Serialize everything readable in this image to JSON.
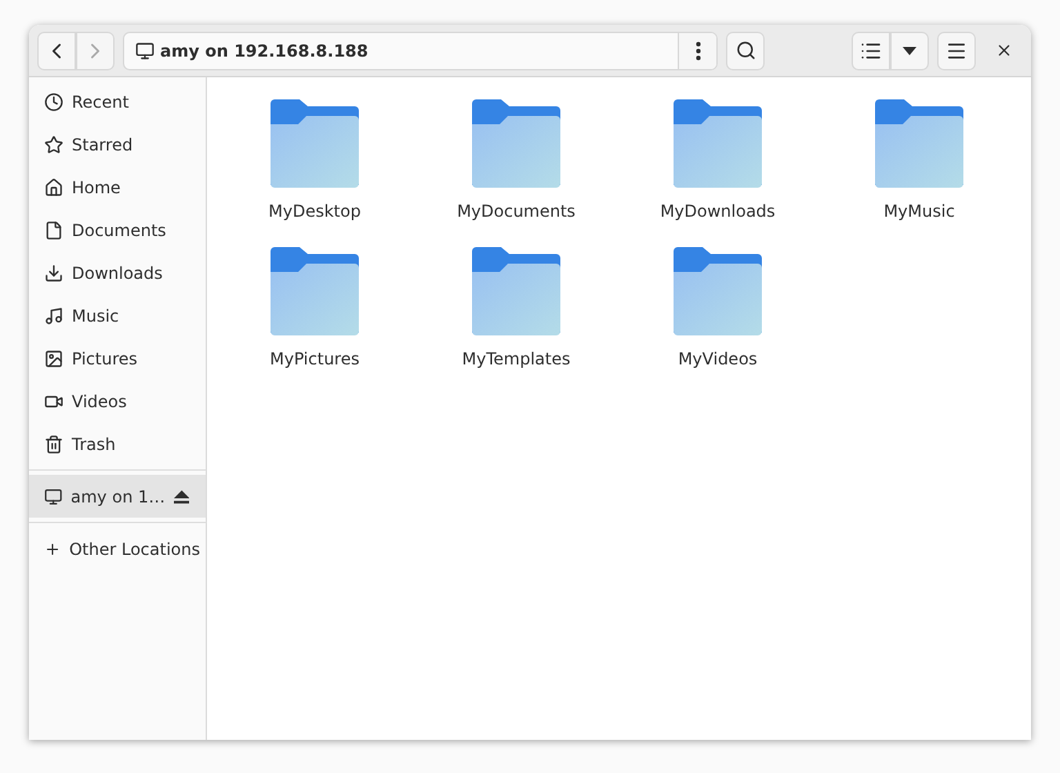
{
  "header": {
    "location": "amy on 192.168.8.188",
    "back_disabled": false,
    "forward_disabled": true
  },
  "sidebar": {
    "places": [
      {
        "label": "Recent",
        "selected": false
      },
      {
        "label": "Starred",
        "selected": false
      },
      {
        "label": "Home",
        "selected": false
      },
      {
        "label": "Documents",
        "selected": false
      },
      {
        "label": "Downloads",
        "selected": false
      },
      {
        "label": "Music",
        "selected": false
      },
      {
        "label": "Pictures",
        "selected": false
      },
      {
        "label": "Videos",
        "selected": false
      },
      {
        "label": "Trash",
        "selected": false
      }
    ],
    "mounts": [
      {
        "label": "amy on 1…",
        "selected": true
      }
    ],
    "other_locations": "Other Locations"
  },
  "folders": [
    {
      "name": "MyDesktop",
      "selected": false
    },
    {
      "name": "MyDocuments",
      "selected": false
    },
    {
      "name": "MyDownloads",
      "selected": false
    },
    {
      "name": "MyMusic",
      "selected": false
    },
    {
      "name": "MyPictures",
      "selected": false
    },
    {
      "name": "MyTemplates",
      "selected": false
    },
    {
      "name": "MyVideos",
      "selected": false
    }
  ]
}
